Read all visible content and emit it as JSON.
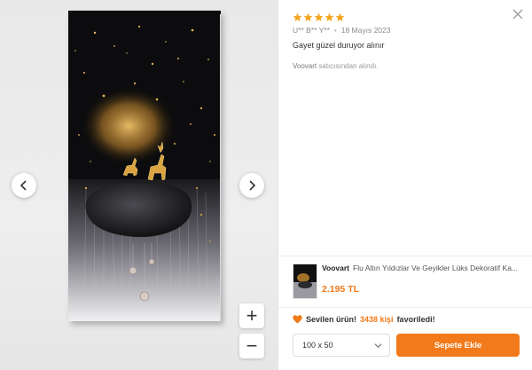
{
  "review": {
    "rating": 5,
    "author": "U** B** Y**",
    "date": "18 Mayıs 2023",
    "separator": "•",
    "comment": "Gayet güzel duruyor alınır",
    "seller_name": "Voovart",
    "seller_suffix": "satıcısından alındı."
  },
  "product": {
    "brand": "Voovart",
    "name": "Flu Altın Yıldızlar Ve Geyikler Lüks Dekoratif Ka...",
    "price": "2.195 TL"
  },
  "favorite": {
    "prefix": "Sevilen ürün!",
    "count": "3438 kişi",
    "suffix": "favoriledi!"
  },
  "size_select": {
    "value": "100 x 50"
  },
  "add_to_cart": {
    "label": "Sepete Ekle"
  },
  "zoom": {
    "in_label": "+",
    "out_label": "−"
  },
  "icons": {
    "close": "close-icon",
    "prev": "chevron-left-icon",
    "next": "chevron-right-icon",
    "star": "star-icon",
    "heart": "heart-icon",
    "dropdown": "chevron-down-icon"
  },
  "colors": {
    "accent": "#f27a1a",
    "star": "#f6a623"
  }
}
